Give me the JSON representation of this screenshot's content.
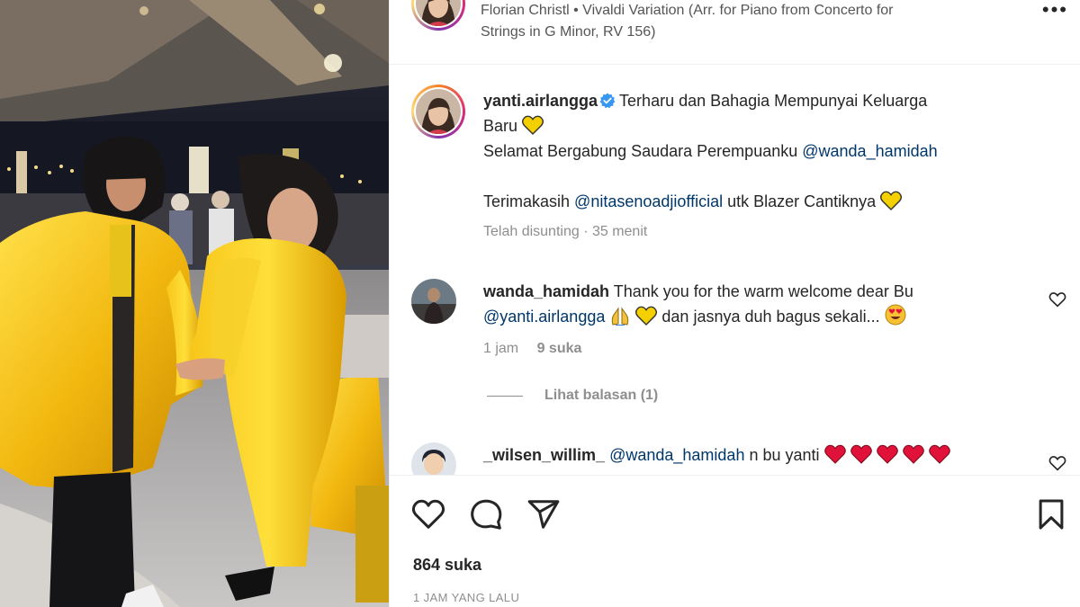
{
  "header": {
    "audio_line1": "Florian Christl • Vivaldi Variation (Arr. for Piano from Concerto for",
    "audio_line2": "Strings in G Minor, RV 156)",
    "more_label": "•••"
  },
  "caption": {
    "username": "yanti.airlangga",
    "text_line1": "Terharu dan Bahagia Mempunyai Keluarga",
    "text_line2": "Baru",
    "text_line3": "Selamat Bergabung Saudara Perempuanku",
    "mention1": "@wanda_hamidah",
    "text_line4": "Terimakasih",
    "mention2": "@nitasenoadjiofficial",
    "text_line4_end": "utk Blazer Cantiknya",
    "meta": "Telah disunting · 35 menit"
  },
  "comments": [
    {
      "username": "wanda_hamidah",
      "text1": "Thank you for the warm welcome dear Bu",
      "mention": "@yanti.airlangga",
      "text2": "dan jasnya duh bagus sekali...",
      "time": "1 jam",
      "likes": "9 suka",
      "replies": "Lihat balasan (1)"
    },
    {
      "username": "_wilsen_willim_",
      "mention": "@wanda_hamidah",
      "text": "n bu yanti"
    }
  ],
  "footer": {
    "likes": "864 suka",
    "time": "1 JAM YANG LALU"
  },
  "icons": {
    "verified": "verified-badge-icon",
    "heart": "heart-icon",
    "comment": "comment-icon",
    "share": "share-icon",
    "save": "bookmark-icon"
  },
  "colors": {
    "mention": "#00376b",
    "verified": "#3897f0",
    "muted": "#8e8e8e",
    "yellow_heart": "#f5d000",
    "red_heart": "#e0123a"
  }
}
